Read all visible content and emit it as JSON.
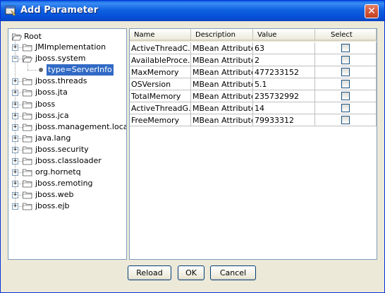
{
  "window": {
    "title": "Add Parameter",
    "close_glyph": "✕"
  },
  "tree": {
    "root": "Root",
    "nodes": [
      {
        "label": "JMImplementation",
        "expander": "+"
      },
      {
        "label": "jboss.system",
        "expander": "−"
      },
      {
        "label": "type=ServerInfo",
        "expander": ""
      },
      {
        "label": "jboss.threads",
        "expander": "+"
      },
      {
        "label": "jboss.jta",
        "expander": "+"
      },
      {
        "label": "jboss",
        "expander": "+"
      },
      {
        "label": "jboss.jca",
        "expander": "+"
      },
      {
        "label": "jboss.management.local",
        "expander": "+"
      },
      {
        "label": "java.lang",
        "expander": "+"
      },
      {
        "label": "jboss.security",
        "expander": "+"
      },
      {
        "label": "jboss.classloader",
        "expander": "+"
      },
      {
        "label": "org.hornetq",
        "expander": "+"
      },
      {
        "label": "jboss.remoting",
        "expander": "+"
      },
      {
        "label": "jboss.web",
        "expander": "+"
      },
      {
        "label": "jboss.ejb",
        "expander": "+"
      }
    ]
  },
  "table": {
    "columns": [
      "Name",
      "Description",
      "Value",
      "Select"
    ],
    "rows": [
      {
        "name": "ActiveThreadC...",
        "description": "MBean Attribute.",
        "value": "63",
        "selected": false
      },
      {
        "name": "AvailableProce...",
        "description": "MBean Attribute.",
        "value": "2",
        "selected": false
      },
      {
        "name": "MaxMemory",
        "description": "MBean Attribute.",
        "value": "477233152",
        "selected": false
      },
      {
        "name": "OSVersion",
        "description": "MBean Attribute.",
        "value": "5.1",
        "selected": false
      },
      {
        "name": "TotalMemory",
        "description": "MBean Attribute.",
        "value": "235732992",
        "selected": false
      },
      {
        "name": "ActiveThreadG...",
        "description": "MBean Attribute.",
        "value": "14",
        "selected": false
      },
      {
        "name": "FreeMemory",
        "description": "MBean Attribute.",
        "value": "79933312",
        "selected": false
      }
    ]
  },
  "buttons": {
    "reload": "Reload",
    "ok": "OK",
    "cancel": "Cancel"
  },
  "colors": {
    "titlebar": "#0a5fdc",
    "selection": "#316ac5",
    "close": "#d2563a"
  },
  "icons": {
    "app": "window-app-icon",
    "close": "close-icon",
    "folder": "folder-icon",
    "open_folder": "open-folder-icon",
    "leaf": "bullet-icon"
  }
}
